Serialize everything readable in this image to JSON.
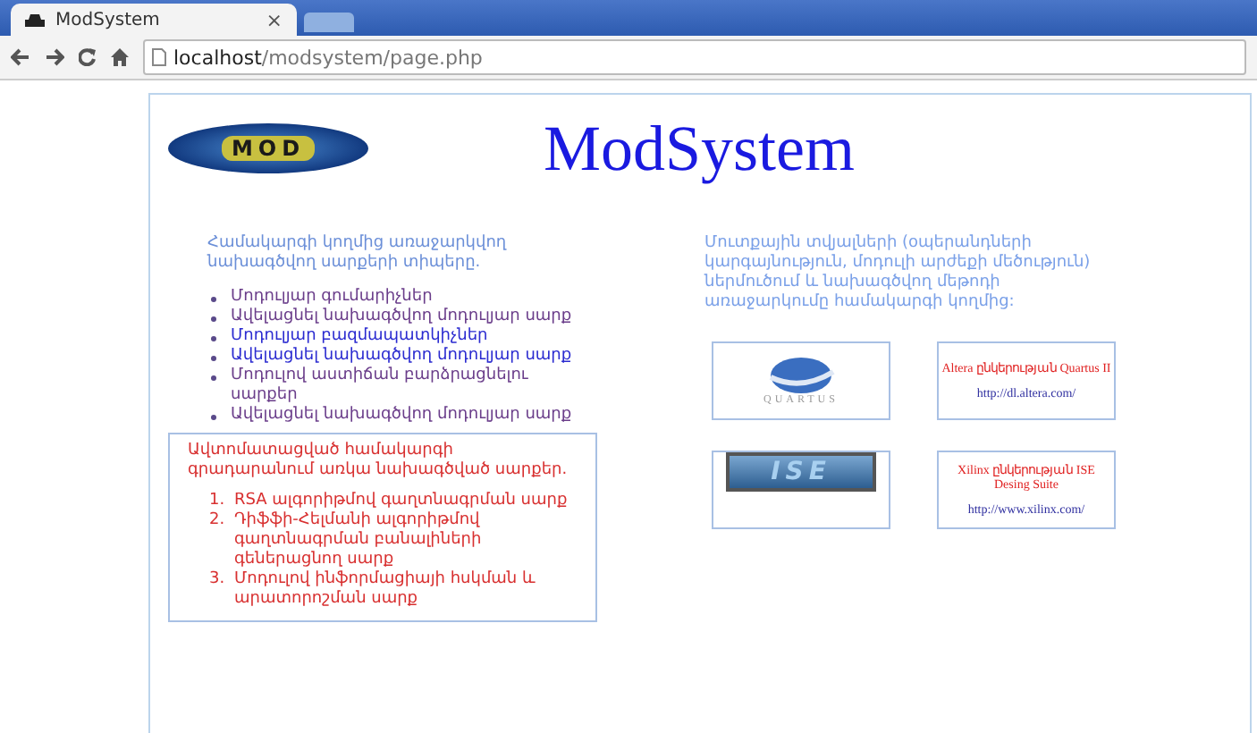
{
  "browser": {
    "tab": {
      "title": "ModSystem",
      "close": "×"
    },
    "address": {
      "host": "localhost",
      "path": "/modsystem/page.php"
    }
  },
  "page": {
    "logo": {
      "text": "MOD"
    },
    "title": "ModSystem",
    "left": {
      "intro": "Համակարգի կողմից առաջարկվող նախագծվող սարքերի տիպերը.",
      "items": [
        {
          "label": "Մոդուլյար գումարիչներ",
          "visited": true
        },
        {
          "label": "Ավելացնել նախագծվող մոդուլյար սարք",
          "visited": true
        },
        {
          "label": "Մոդուլյար բազմապատկիչներ",
          "visited": false
        },
        {
          "label": "Ավելացնել նախագծվող մոդուլյար սարք",
          "visited": false
        },
        {
          "label": "Մոդուլով աստիճան բարձրացնելու սարքեր",
          "visited": true
        },
        {
          "label": "Ավելացնել նախագծվող մոդուլյար սարք",
          "visited": true
        }
      ]
    },
    "library": {
      "heading": "Ավտոմատացված համակարգի գրադարանում առկա նախագծված սարքեր.",
      "items": [
        {
          "number": "1.",
          "label": "RSA ալգորիթմով գաղտնագրման սարք"
        },
        {
          "number": "2.",
          "label": "Դիֆֆի-Հելմանի ալգորիթմով գաղտնագրման բանալիների գեներացնող սարք"
        },
        {
          "number": "3.",
          "label": "Մոդուլով ինֆորմացիայի հսկման և արատորոշման սարք"
        }
      ]
    },
    "right": {
      "intro": "Մուտքային տվյալների (օպերանդների կարգայնություն, մոդուլի արժեքի մեծություն) ներմուծում և նախագծվող մեթոդի առաջարկումը համակարգի կողմից:",
      "tools": [
        {
          "logo": {
            "kind": "quartus",
            "text": "QUARTUS"
          },
          "name": "Altera ընկերության Quartus II",
          "url": "http://dl.altera.com/"
        },
        {
          "logo": {
            "kind": "ise",
            "text": "ISE"
          },
          "name": "Xilinx ընկերության ISE Desing Suite",
          "url": "http://www.xilinx.com/"
        }
      ]
    }
  }
}
